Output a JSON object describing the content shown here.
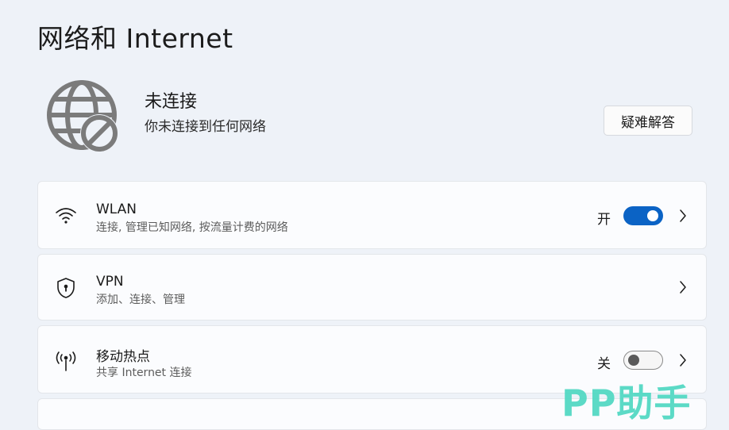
{
  "page": {
    "title": "网络和 Internet"
  },
  "connection_status": {
    "icon": "globe-disconnected-icon",
    "title": "未连接",
    "subtitle": "你未连接到任何网络",
    "troubleshoot_label": "疑难解答"
  },
  "settings": {
    "wlan": {
      "icon": "wifi-icon",
      "title": "WLAN",
      "description": "连接, 管理已知网络, 按流量计费的网络",
      "toggle_label": "开",
      "toggle_on": true
    },
    "vpn": {
      "icon": "shield-icon",
      "title": "VPN",
      "description": "添加、连接、管理"
    },
    "hotspot": {
      "icon": "hotspot-antenna-icon",
      "title": "移动热点",
      "description": "共享 Internet 连接",
      "toggle_label": "关",
      "toggle_on": false
    }
  },
  "watermark": {
    "text": "PP助手"
  },
  "colors": {
    "accent": "#0b63c5",
    "background": "#eef2f8",
    "card": "#fbfcfe",
    "watermark": "#4fd8c2"
  }
}
